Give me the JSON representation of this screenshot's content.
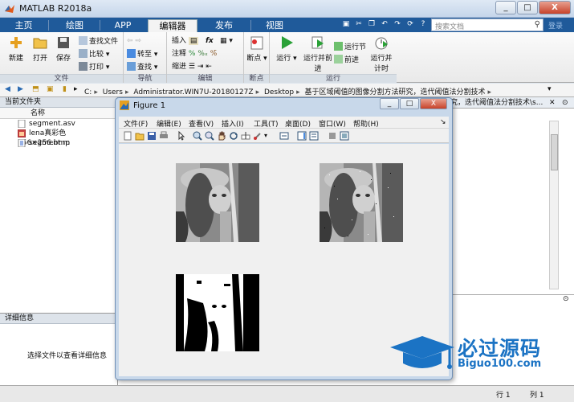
{
  "window": {
    "title": "MATLAB R2018a",
    "minimize": "_",
    "maximize": "□",
    "close": "X"
  },
  "tabs": [
    "主页",
    "绘图",
    "APP",
    "编辑器",
    "发布",
    "视图"
  ],
  "active_tab": "编辑器",
  "search": {
    "placeholder": "搜索文档",
    "signin": "登录"
  },
  "ribbon": {
    "file": {
      "label": "文件",
      "new": "新建",
      "open": "打开",
      "save": "保存",
      "find_files": "查找文件",
      "compare": "比较",
      "print": "打印"
    },
    "nav": {
      "label": "导航",
      "goto": "转至",
      "find": "查找"
    },
    "edit": {
      "label": "编辑",
      "insert": "插入",
      "comment": "注释",
      "indent": "缩进",
      "fx": "fx"
    },
    "breakpoints": {
      "label": "断点",
      "breakpoints": "断点"
    },
    "run": {
      "label": "运行",
      "run": "运行",
      "run_advance": "运行并前进",
      "run_section": "运行节",
      "advance": "前进",
      "run_time": "运行并计时"
    }
  },
  "address": {
    "parts": [
      "C:",
      "Users",
      "Administrator.WIN7U-20180127Z",
      "Desktop",
      "基于区域阈值的图像分割方法研究，迭代阈值法分割技术"
    ]
  },
  "current_folder": {
    "title": "当前文件夹",
    "column": "名称",
    "files": [
      "segment.asv",
      "lena真彩色256×256.bmp",
      "segment.m"
    ]
  },
  "details": {
    "title": "详细信息",
    "hint": "选择文件以查看详细信息"
  },
  "editor_tab": "究，迭代阈值法分割技术\\s...",
  "figure": {
    "title": "Figure 1",
    "menu": [
      "文件(F)",
      "编辑(E)",
      "查看(V)",
      "插入(I)",
      "工具(T)",
      "桌面(D)",
      "窗口(W)",
      "帮助(H)"
    ]
  },
  "status": {
    "row_label": "行",
    "row": "1",
    "col_label": "列",
    "col": "1"
  },
  "watermark": {
    "main": "必过源码",
    "sub": "Biguo100.com"
  },
  "colors": {
    "tab_bar": "#1f5a9a",
    "accent": "#1b73c4"
  }
}
